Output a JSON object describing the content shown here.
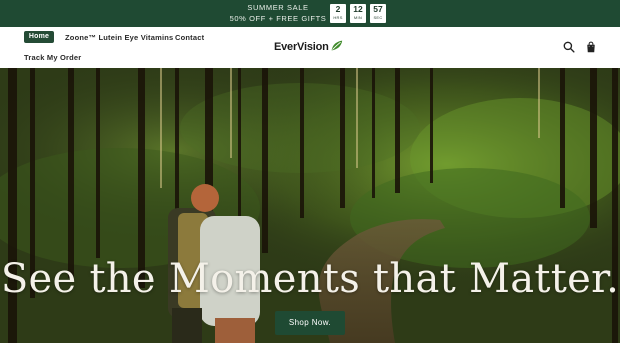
{
  "promo": {
    "line1": "SUMMER SALE",
    "line2": "50% OFF + FREE GIFTS",
    "timer": [
      {
        "value": "2",
        "unit": "HRS"
      },
      {
        "value": "12",
        "unit": "MIN"
      },
      {
        "value": "57",
        "unit": "SEC"
      }
    ]
  },
  "nav": {
    "home": "Home",
    "zoone": "Zoone™ Lutein Eye Vitamins",
    "contact": "Contact",
    "track": "Track My Order"
  },
  "logo": {
    "text": "EverVision"
  },
  "icons": {
    "search": "search-icon",
    "bag": "shopping-bag-icon",
    "leaf": "leaf-icon"
  },
  "hero": {
    "title": "See the Moments that Matter.",
    "button": "Shop Now."
  },
  "colors": {
    "brand_green": "#1f4a33",
    "accent_leaf": "#3f8a2a"
  }
}
